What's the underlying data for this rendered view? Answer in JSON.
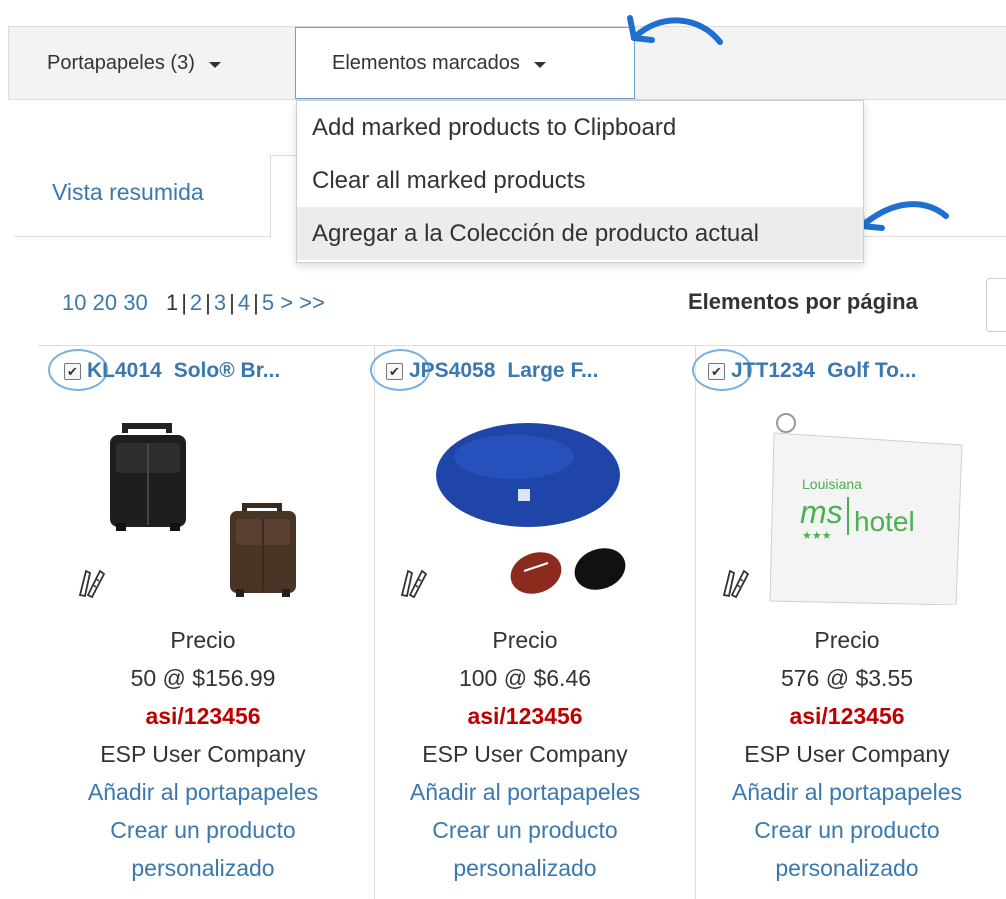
{
  "toolbar": {
    "clipboard_label": "Portapapeles (3)",
    "marked_label": "Elementos marcados"
  },
  "dropdown": {
    "items": [
      {
        "label": "Add marked products to Clipboard"
      },
      {
        "label": "Clear all marked products"
      },
      {
        "label": "Agregar a la Colección de producto actual"
      }
    ]
  },
  "tabs": {
    "summary_label": "Vista resumida"
  },
  "pager": {
    "sizes": [
      "10",
      "20",
      "30"
    ],
    "current": "1",
    "pages": [
      "2",
      "3",
      "4",
      "5"
    ],
    "next": ">",
    "last": ">>",
    "per_page_label": "Elementos por página"
  },
  "products": [
    {
      "code": "KL4014",
      "name": "Solo® Br...",
      "price_label": "Precio",
      "price": "50 @ $156.99",
      "asi": "asi/123456",
      "company": "ESP User Company",
      "add_label": "Añadir al portapapeles",
      "custom_label_1": "Crear un producto",
      "custom_label_2": "personalizado"
    },
    {
      "code": "JPS4058",
      "name": "Large F...",
      "price_label": "Precio",
      "price": "100 @ $6.46",
      "asi": "asi/123456",
      "company": "ESP User Company",
      "add_label": "Añadir al portapapeles",
      "custom_label_1": "Crear un producto",
      "custom_label_2": "personalizado"
    },
    {
      "code": "JTT1234",
      "name": "Golf To...",
      "price_label": "Precio",
      "price": "576 @ $3.55",
      "asi": "asi/123456",
      "company": "ESP User Company",
      "add_label": "Añadir al portapapeles",
      "custom_label_1": "Crear un producto",
      "custom_label_2": "personalizado",
      "image_text_1": "Louisiana",
      "image_text_2": "ms",
      "image_text_3": "hotel"
    }
  ],
  "colors": {
    "link": "#3a78ad",
    "asi": "#c00000",
    "annotation": "#1f6fd1"
  }
}
